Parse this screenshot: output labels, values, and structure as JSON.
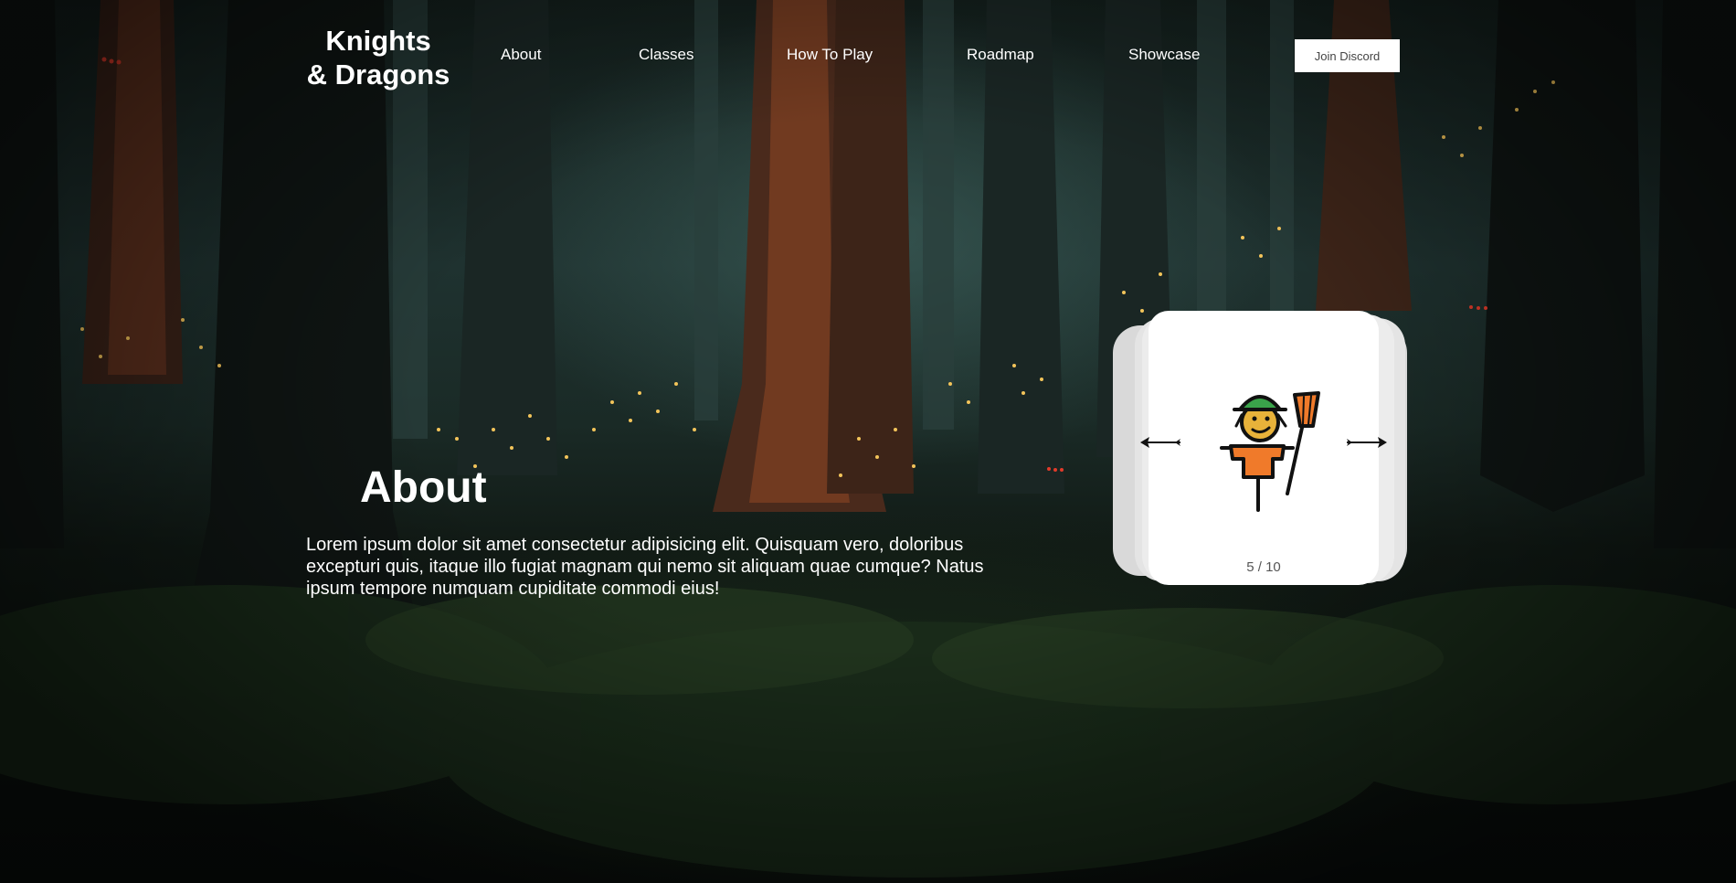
{
  "brand": {
    "line1": "Knights",
    "line2": "& Dragons"
  },
  "nav": {
    "items": [
      "About",
      "Classes",
      "How To Play",
      "Roadmap",
      "Showcase"
    ],
    "cta_label": "Join Discord"
  },
  "about": {
    "title": "About",
    "body": "Lorem ipsum dolor sit amet consectetur adipisicing elit. Quisquam vero, doloribus excepturi quis, itaque illo fugiat magnam qui nemo sit aliquam quae cumque? Natus ipsum tempore numquam cupiditate commodi eius!"
  },
  "carousel": {
    "counter": "5 / 10",
    "prev_icon": "arrow-left-icon",
    "next_icon": "arrow-right-icon",
    "image": "scarecrow-character"
  },
  "colors": {
    "card_front": "#ffffff",
    "card_back": "#d9d9d9",
    "text": "#ffffff",
    "hat": "#3aa34a",
    "shirt": "#f07a2a",
    "face": "#e8b23a"
  }
}
